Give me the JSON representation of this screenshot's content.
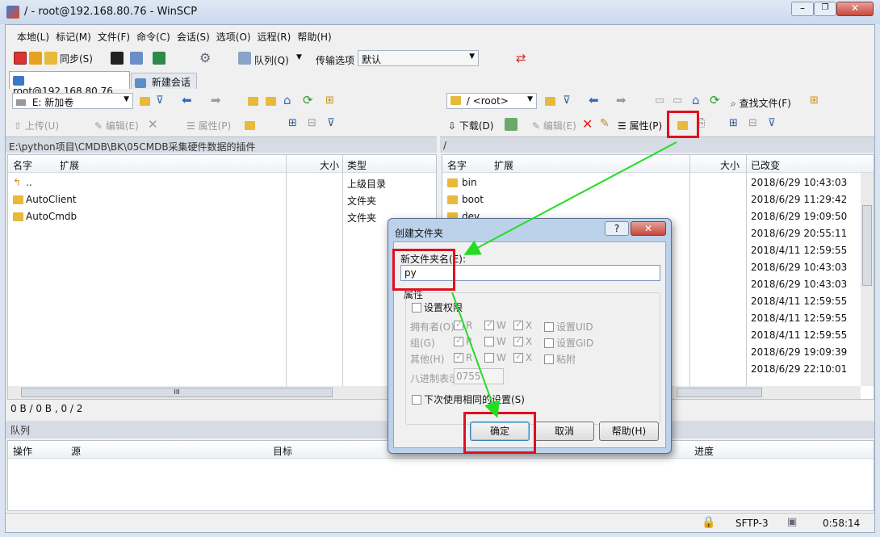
{
  "window": {
    "title": "/ - root@192.168.80.76 - WinSCP"
  },
  "menu": [
    "本地(L)",
    "标记(M)",
    "文件(F)",
    "命令(C)",
    "会话(S)",
    "选项(O)",
    "远程(R)",
    "帮助(H)"
  ],
  "toolbar": {
    "sync": "同步(S)",
    "queue": "队列(Q)",
    "transfer_label": "传输选项",
    "transfer_value": "默认"
  },
  "tabs": {
    "session": "root@192.168.80.76",
    "new_session": "新建会话"
  },
  "local": {
    "drive": "E: 新加卷",
    "upload": "上传(U)",
    "edit": "编辑(E)",
    "props": "属性(P)",
    "path": "E:\\python项目\\CMDB\\BK\\05CMDB采集硬件数据的插件",
    "cols": {
      "name": "名字",
      "ext": "扩展",
      "size": "大小",
      "type": "类型"
    },
    "rows": [
      {
        "name": "..",
        "type": "上级目录"
      },
      {
        "name": "AutoClient",
        "type": "文件夹"
      },
      {
        "name": "AutoCmdb",
        "type": "文件夹"
      }
    ],
    "status": "0 B / 0 B , 0 / 2",
    "scroll_glyph": "III"
  },
  "remote": {
    "dir": "/ <root>",
    "find": "查找文件(F)",
    "download": "下载(D)",
    "edit": "编辑(E)",
    "props": "属性(P)",
    "path": "/",
    "cols": {
      "name": "名字",
      "ext": "扩展",
      "size": "大小",
      "changed": "已改变"
    },
    "rows": [
      {
        "name": "bin",
        "date": "2018/6/29 10:43:03"
      },
      {
        "name": "boot",
        "date": "2018/6/29 11:29:42"
      },
      {
        "name": "dev",
        "date": "2018/6/29 19:09:50"
      },
      {
        "name": "",
        "date": "2018/6/29 20:55:11"
      },
      {
        "name": "",
        "date": "2018/4/11 12:59:55"
      },
      {
        "name": "",
        "date": "2018/6/29 10:43:03"
      },
      {
        "name": "",
        "date": "2018/6/29 10:43:03"
      },
      {
        "name": "",
        "date": "2018/4/11 12:59:55"
      },
      {
        "name": "",
        "date": "2018/4/11 12:59:55"
      },
      {
        "name": "",
        "date": "2018/4/11 12:59:55"
      },
      {
        "name": "",
        "date": "2018/6/29 19:09:39"
      },
      {
        "name": "",
        "date": "2018/6/29 22:10:01"
      }
    ]
  },
  "queue": {
    "title": "队列",
    "cols": {
      "op": "操作",
      "src": "源",
      "dst": "目标",
      "progress": "进度"
    }
  },
  "statusbar": {
    "protocol": "SFTP-3",
    "time": "0:58:14"
  },
  "dialog": {
    "title": "创建文件夹",
    "help_glyph": "?",
    "close_glyph": "✕",
    "name_label": "新文件夹名(E):",
    "name_value": "py",
    "attrs": "属性",
    "set_perms": "设置权限",
    "owner": "拥有者(O)",
    "group": "组(G)",
    "other": "其他(H)",
    "r": "R",
    "w": "W",
    "x": "X",
    "uid": "设置UID",
    "gid": "设置GID",
    "sticky": "粘附",
    "octal_label": "八进制表示",
    "octal_value": "0755",
    "reuse": "下次使用相同的设置(S)",
    "ok": "确定",
    "cancel": "取消",
    "help": "帮助(H)"
  },
  "colors": {
    "annotation_red": "#e0101f",
    "annotation_green": "#22dd22",
    "folder": "#e8b93a"
  }
}
